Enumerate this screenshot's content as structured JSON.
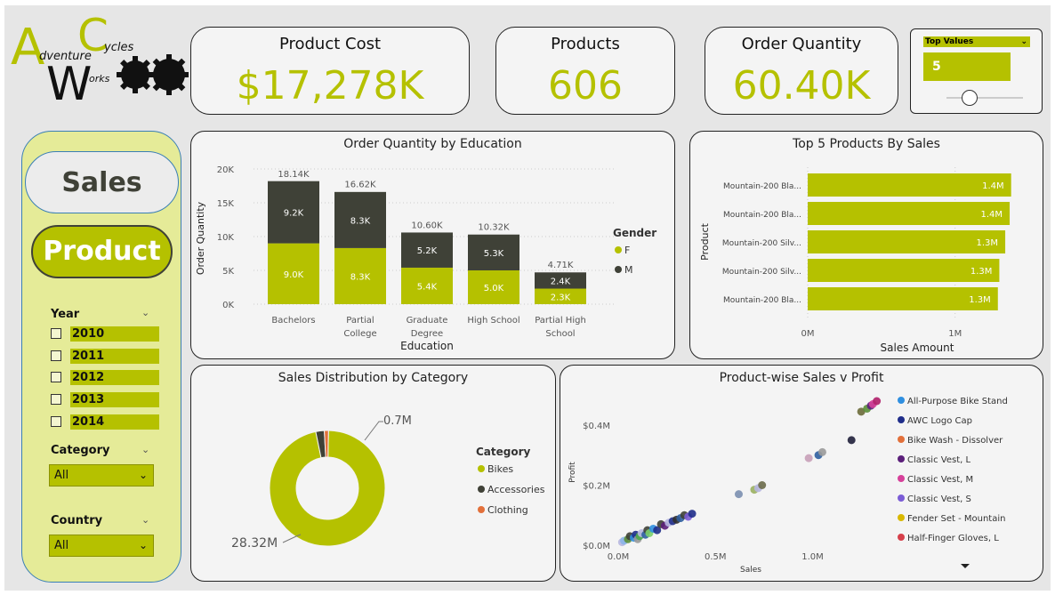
{
  "logo": {
    "letter_a": "A",
    "letter_c": "C",
    "letter_w": "W",
    "word_adventure": "dventure",
    "word_cycles": "ycles",
    "word_works": "orks"
  },
  "kpis": [
    {
      "title": "Product Cost",
      "value": "$17,278K"
    },
    {
      "title": "Products",
      "value": "606"
    },
    {
      "title": "Order Quantity",
      "value": "60.40K"
    }
  ],
  "top_values": {
    "label": "Top Values",
    "value": "5",
    "slider_fraction": 0.3
  },
  "nav": {
    "sales": "Sales",
    "product": "Product"
  },
  "filters": {
    "year": {
      "label": "Year",
      "options": [
        "2010",
        "2011",
        "2012",
        "2013",
        "2014"
      ]
    },
    "category": {
      "label": "Category",
      "selected": "All"
    },
    "country": {
      "label": "Country",
      "selected": "All"
    }
  },
  "colors": {
    "accent": "#b5c100",
    "dark": "#3f4137",
    "clothing": "#e2703a"
  },
  "charts": {
    "education": {
      "title": "Order Quantity by Education",
      "xlabel": "Education",
      "ylabel": "Order Quantity",
      "legend_title": "Gender",
      "yticks": [
        "0K",
        "5K",
        "10K",
        "15K",
        "20K"
      ],
      "series_names": [
        "F",
        "M"
      ]
    },
    "top5": {
      "title": "Top 5 Products By Sales",
      "xlabel": "Sales Amount",
      "ylabel": "Product",
      "xticks": [
        "0M",
        "1M"
      ]
    },
    "category": {
      "title": "Sales Distribution by Category",
      "legend_title": "Category",
      "labels": [
        "28.32M",
        "0.7M"
      ]
    },
    "scatter": {
      "title": "Product-wise Sales v Profit",
      "xlabel": "Sales",
      "ylabel": "Profit",
      "xticks": [
        "0.0M",
        "0.5M",
        "1.0M"
      ],
      "yticks": [
        "$0.0M",
        "$0.2M",
        "$0.4M"
      ]
    }
  },
  "chart_data": [
    {
      "type": "bar",
      "title": "Order Quantity by Education",
      "xlabel": "Education",
      "ylabel": "Order Quantity",
      "categories": [
        "Bachelors",
        "Partial College",
        "Graduate Degree",
        "High School",
        "Partial High School"
      ],
      "series": [
        {
          "name": "F",
          "values": [
            9.0,
            8.3,
            5.4,
            5.0,
            2.3
          ],
          "labels": [
            "9.0K",
            "8.3K",
            "5.4K",
            "5.0K",
            "2.3K"
          ],
          "color": "#b5c100"
        },
        {
          "name": "M",
          "values": [
            9.2,
            8.3,
            5.2,
            5.3,
            2.4
          ],
          "labels": [
            "9.2K",
            "8.3K",
            "5.2K",
            "5.3K",
            "2.4K"
          ],
          "color": "#3f4137"
        }
      ],
      "totals": [
        "18.14K",
        "16.62K",
        "10.60K",
        "10.32K",
        "4.71K"
      ],
      "total_values": [
        18.14,
        16.62,
        10.6,
        10.32,
        4.71
      ],
      "ylim": [
        0,
        20
      ],
      "legend": "right",
      "stacked": true
    },
    {
      "type": "bar",
      "orientation": "horizontal",
      "title": "Top 5 Products By Sales",
      "xlabel": "Sales Amount",
      "ylabel": "Product",
      "categories": [
        "Mountain-200 Bla...",
        "Mountain-200 Bla...",
        "Mountain-200 Silv...",
        "Mountain-200 Silv...",
        "Mountain-200 Bla..."
      ],
      "values": [
        1.38,
        1.37,
        1.34,
        1.3,
        1.29
      ],
      "labels": [
        "1.4M",
        "1.4M",
        "1.3M",
        "1.3M",
        "1.3M"
      ],
      "xlim": [
        0,
        1.4
      ]
    },
    {
      "type": "pie",
      "donut": true,
      "title": "Sales Distribution by Category",
      "categories": [
        "Bikes",
        "Accessories",
        "Clothing"
      ],
      "values": [
        28.32,
        0.7,
        0.34
      ],
      "colors": [
        "#b5c100",
        "#3f4137",
        "#e2703a"
      ],
      "legend": "right"
    },
    {
      "type": "scatter",
      "title": "Product-wise Sales v Profit",
      "xlabel": "Sales",
      "ylabel": "Profit",
      "xlim": [
        0,
        1.35
      ],
      "ylim": [
        0,
        0.48
      ],
      "legend_items": [
        {
          "name": "All-Purpose Bike Stand",
          "color": "#2f8fe0"
        },
        {
          "name": "AWC Logo Cap",
          "color": "#1f2d8a"
        },
        {
          "name": "Bike Wash - Dissolver",
          "color": "#e2703a"
        },
        {
          "name": "Classic Vest, L",
          "color": "#5b1f7a"
        },
        {
          "name": "Classic Vest, M",
          "color": "#d6409a"
        },
        {
          "name": "Classic Vest, S",
          "color": "#7b5cd6"
        },
        {
          "name": "Fender Set - Mountain",
          "color": "#d9b800"
        },
        {
          "name": "Half-Finger Gloves, L",
          "color": "#d6404a"
        }
      ],
      "points": [
        [
          0.02,
          0.01,
          "#b7b7e0"
        ],
        [
          0.03,
          0.015,
          "#8ab4e8"
        ],
        [
          0.05,
          0.02,
          "#5b8f3a"
        ],
        [
          0.06,
          0.03,
          "#3f4137"
        ],
        [
          0.08,
          0.025,
          "#2f8fe0"
        ],
        [
          0.09,
          0.035,
          "#1f2d8a"
        ],
        [
          0.1,
          0.02,
          "#9a9a9a"
        ],
        [
          0.11,
          0.03,
          "#4aa84a"
        ],
        [
          0.12,
          0.04,
          "#b7b7e0"
        ],
        [
          0.14,
          0.035,
          "#2f5fa0"
        ],
        [
          0.15,
          0.05,
          "#3f4137"
        ],
        [
          0.16,
          0.04,
          "#7bd06b"
        ],
        [
          0.18,
          0.055,
          "#2f8fe0"
        ],
        [
          0.2,
          0.05,
          "#1f2d8a"
        ],
        [
          0.22,
          0.07,
          "#3f4137"
        ],
        [
          0.24,
          0.065,
          "#5b1f7a"
        ],
        [
          0.26,
          0.075,
          "#b7b7e0"
        ],
        [
          0.28,
          0.08,
          "#1f2d8a"
        ],
        [
          0.3,
          0.085,
          "#2f2f2f"
        ],
        [
          0.32,
          0.09,
          "#2f5fa0"
        ],
        [
          0.34,
          0.1,
          "#3f4137"
        ],
        [
          0.36,
          0.095,
          "#7b5cd6"
        ],
        [
          0.38,
          0.105,
          "#1f2d8a"
        ],
        [
          0.62,
          0.17,
          "#7b8fb0"
        ],
        [
          0.7,
          0.185,
          "#9ab060"
        ],
        [
          0.72,
          0.19,
          "#b7b7e0"
        ],
        [
          0.74,
          0.2,
          "#6b6b4a"
        ],
        [
          0.98,
          0.29,
          "#c8a0b8"
        ],
        [
          1.03,
          0.3,
          "#2f5fa0"
        ],
        [
          1.05,
          0.31,
          "#9a9a9a"
        ],
        [
          1.2,
          0.35,
          "#1f1f3a"
        ],
        [
          1.25,
          0.445,
          "#6b6b3a"
        ],
        [
          1.28,
          0.455,
          "#5b8f3a"
        ],
        [
          1.3,
          0.465,
          "#5b1f7a"
        ],
        [
          1.31,
          0.47,
          "#d6409a"
        ],
        [
          1.33,
          0.48,
          "#b01f6a"
        ]
      ]
    }
  ]
}
